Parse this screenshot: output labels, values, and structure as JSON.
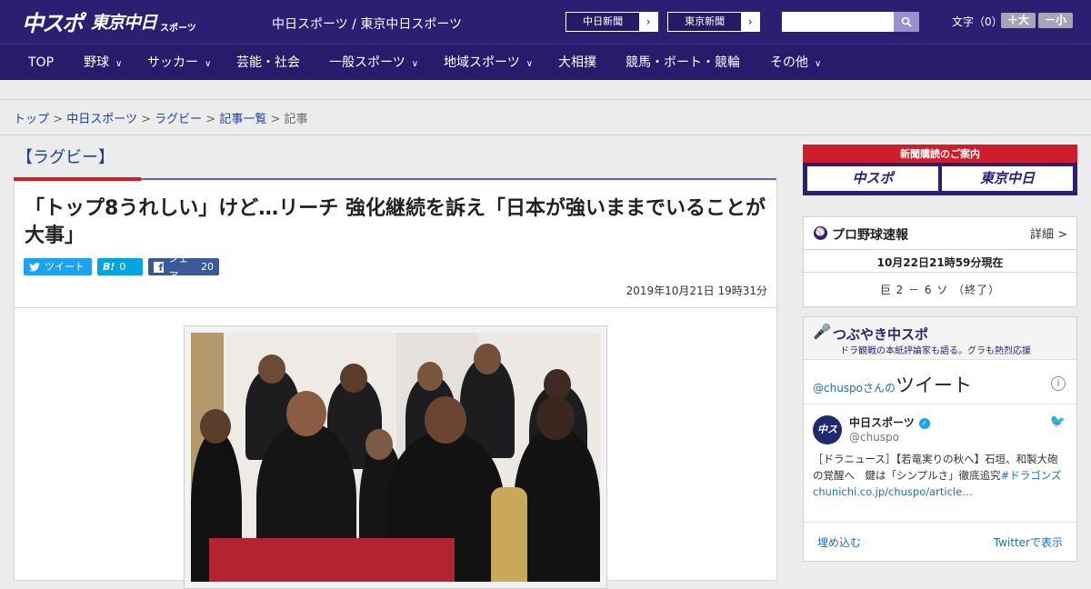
{
  "header": {
    "logo_main": "中スポ",
    "logo_secondary": "東京中日",
    "logo_small": "スポーツ",
    "site_name": "中日スポーツ / 東京中日スポーツ",
    "paper_links": [
      "中日新聞",
      "東京新聞"
    ],
    "font_size_label": "文字（0）",
    "font_larger": "＋大",
    "font_smaller": "－小"
  },
  "nav": {
    "items": [
      {
        "label": "TOP",
        "dropdown": false
      },
      {
        "label": "野球",
        "dropdown": true
      },
      {
        "label": "サッカー",
        "dropdown": true
      },
      {
        "label": "芸能・社会",
        "dropdown": false
      },
      {
        "label": "一般スポーツ",
        "dropdown": true
      },
      {
        "label": "地域スポーツ",
        "dropdown": true
      },
      {
        "label": "大相撲",
        "dropdown": false
      },
      {
        "label": "競馬・ボート・競輪",
        "dropdown": false
      },
      {
        "label": "その他",
        "dropdown": true
      }
    ]
  },
  "breadcrumb": {
    "items": [
      "トップ",
      "中日スポーツ",
      "ラグビー",
      "記事一覧"
    ],
    "current": "記事",
    "separator": ">"
  },
  "article": {
    "category": "【ラグビー】",
    "headline": "「トップ8うれしい」けど…リーチ 強化継続を訴え「日本が強いままでいることが大事」",
    "share": {
      "tweet_label": "ツイート",
      "hatena_label": "B!",
      "hatena_count": "0",
      "facebook_label": "シェア",
      "facebook_count": "20"
    },
    "date": "2019年10月21日 19時31分"
  },
  "sidebar": {
    "subscription": {
      "title": "新聞購読のご案内",
      "left": "中スポ",
      "right": "東京中日"
    },
    "baseball": {
      "title": "プロ野球速報",
      "detail": "詳細 >",
      "updated": "10月22日21時59分現在",
      "score": "巨 2 － 6 ソ （終了）"
    },
    "tweets": {
      "title": "つぶやき中スポ",
      "subtitle": "ドラ観戦の本紙評論家も語る。グラも熱烈応援",
      "header_handle": "@chuspoさんの",
      "header_big": "ツイート",
      "account_name": "中日スポーツ",
      "account_handle": "@chuspo",
      "avatar_text": "中スポ",
      "text_plain": "［ドラニュース］【若竜実りの秋へ】石垣、和製大砲の覚醒へ　鍵は「シンプルさ」徹底追究",
      "text_link": "#ドラゴンズchunichi.co.jp/chuspo/article…",
      "embed_label": "埋め込む",
      "view_label": "Twitterで表示"
    }
  },
  "colors": {
    "brand_navy": "#2a1f72",
    "accent_red": "#d11e24",
    "link_blue": "#1f3fa0"
  }
}
